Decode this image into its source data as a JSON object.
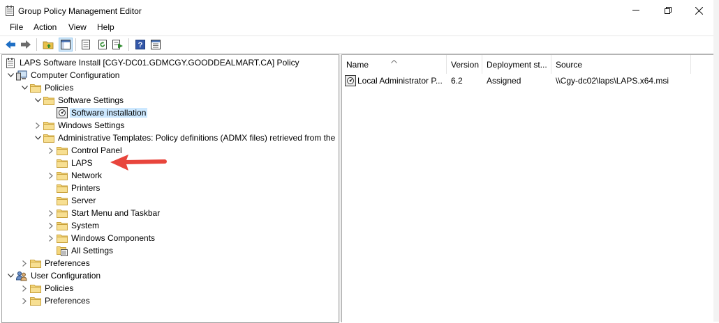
{
  "window": {
    "title": "Group Policy Management Editor"
  },
  "menu": [
    "File",
    "Action",
    "View",
    "Help"
  ],
  "toolbar": [
    "back-arrow-icon",
    "forward-arrow-icon",
    "up-folder-icon",
    "show-hide-tree-icon",
    "properties-icon",
    "refresh-icon",
    "export-list-icon",
    "help-icon",
    "toggle-view-icon"
  ],
  "tree": {
    "root": "LAPS Software Install [CGY-DC01.GDMCGY.GOODDEALMART.CA] Policy",
    "computer_configuration": "Computer Configuration",
    "policies": "Policies",
    "software_settings": "Software Settings",
    "software_installation": "Software installation",
    "windows_settings": "Windows Settings",
    "admin_templates": "Administrative Templates: Policy definitions (ADMX files) retrieved from the",
    "control_panel": "Control Panel",
    "laps": "LAPS",
    "network": "Network",
    "printers": "Printers",
    "server": "Server",
    "start_menu": "Start Menu and Taskbar",
    "system": "System",
    "windows_components": "Windows Components",
    "all_settings": "All Settings",
    "preferences": "Preferences",
    "user_configuration": "User Configuration",
    "user_policies": "Policies",
    "user_preferences": "Preferences"
  },
  "list": {
    "headers": {
      "name": "Name",
      "version": "Version",
      "deployment": "Deployment st...",
      "source": "Source"
    },
    "rows": [
      {
        "name": "Local Administrator P...",
        "version": "6.2",
        "deployment": "Assigned",
        "source": "\\\\Cgy-dc02\\laps\\LAPS.x64.msi"
      }
    ]
  },
  "colors": {
    "selection": "#cce8ff",
    "folder": "#dcb35c",
    "arrow": "#e8453c"
  }
}
